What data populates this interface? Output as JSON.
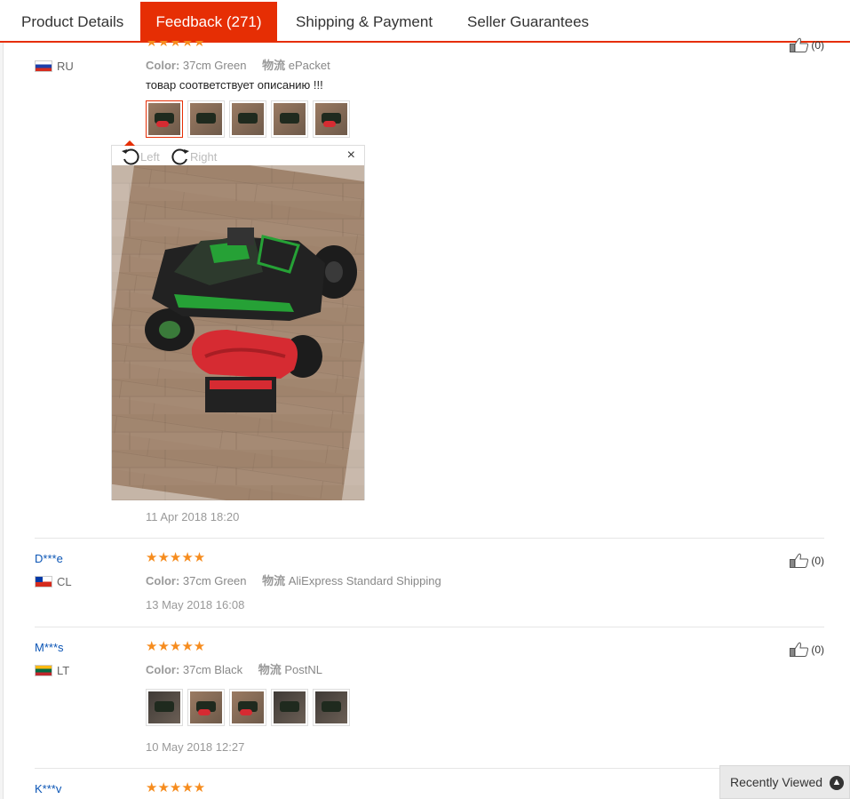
{
  "tabs": [
    {
      "label": "Product Details"
    },
    {
      "label": "Feedback (271)"
    },
    {
      "label": "Shipping & Payment"
    },
    {
      "label": "Seller Guarantees"
    }
  ],
  "reviews": [
    {
      "user": "",
      "country": "RU",
      "stars": "★★★★★",
      "color_label": "Color:",
      "color_value": "37cm Green",
      "shipping_label": "物流",
      "shipping_value": "ePacket",
      "text": "товар соответствует описанию !!!",
      "date": "11 Apr 2018 18:20",
      "likes": "(0)"
    },
    {
      "user": "D***e",
      "country": "CL",
      "stars": "★★★★★",
      "color_label": "Color:",
      "color_value": "37cm Green",
      "shipping_label": "物流",
      "shipping_value": "AliExpress Standard Shipping",
      "date": "13 May 2018 16:08",
      "likes": "(0)"
    },
    {
      "user": "M***s",
      "country": "LT",
      "stars": "★★★★★",
      "color_label": "Color:",
      "color_value": "37cm Black",
      "shipping_label": "物流",
      "shipping_value": "PostNL",
      "date": "10 May 2018 12:27",
      "likes": "(0)"
    },
    {
      "user": "K***v",
      "stars": "★★★★★"
    }
  ],
  "viewer": {
    "rotate_left": "Left",
    "rotate_right": "Right",
    "close": "×"
  },
  "recently_viewed": {
    "label": "Recently Viewed",
    "icon": "chevron-up-icon"
  },
  "colors": {
    "accent": "#e62e04",
    "star": "#f68c1e",
    "user_link": "#0b55b5"
  }
}
